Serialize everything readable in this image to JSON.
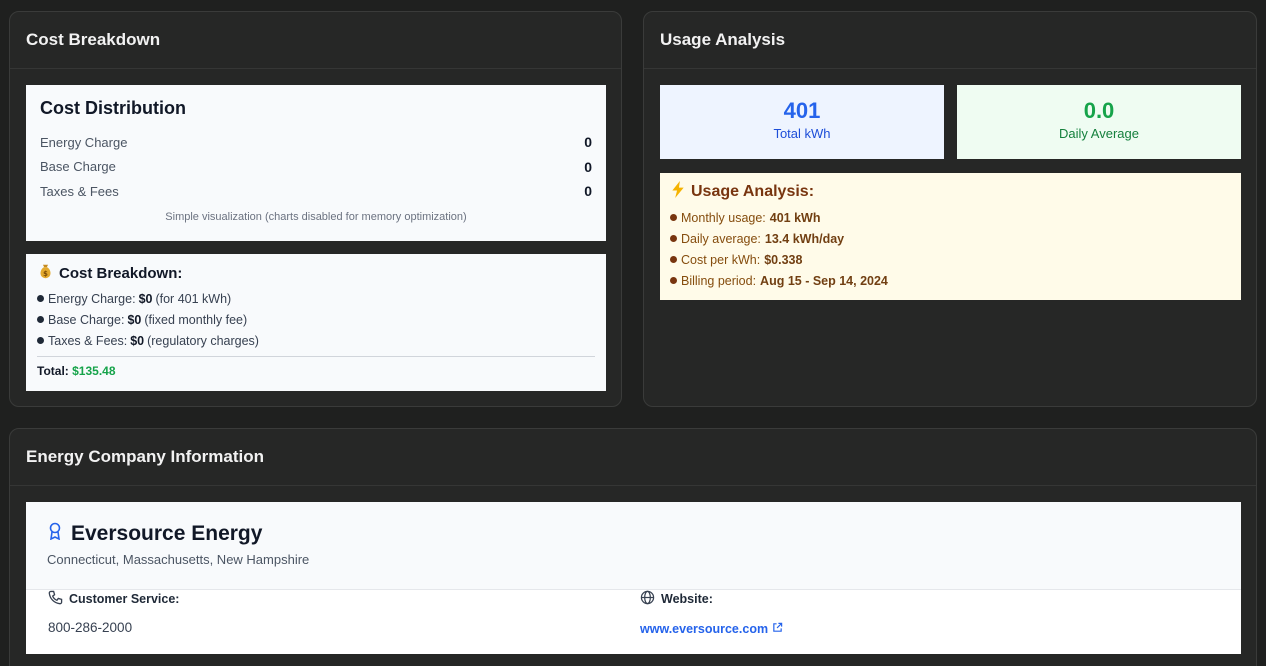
{
  "cost_card": {
    "title": "Cost Breakdown",
    "distribution": {
      "title": "Cost Distribution",
      "rows": [
        {
          "label": "Energy Charge",
          "value": "0"
        },
        {
          "label": "Base Charge",
          "value": "0"
        },
        {
          "label": "Taxes & Fees",
          "value": "0"
        }
      ],
      "note": "Simple visualization (charts disabled for memory optimization)"
    },
    "breakdown": {
      "icon": "money-bag-icon",
      "title": "Cost Breakdown:",
      "lines": [
        {
          "label": "Energy Charge:",
          "amount": "$0",
          "detail": "(for 401 kWh)"
        },
        {
          "label": "Base Charge:",
          "amount": "$0",
          "detail": "(fixed monthly fee)"
        },
        {
          "label": "Taxes & Fees:",
          "amount": "$0",
          "detail": "(regulatory charges)"
        }
      ],
      "total_label": "Total:",
      "total_value": "$135.48"
    }
  },
  "usage_card": {
    "title": "Usage Analysis",
    "stats": {
      "total_value": "401",
      "total_label": "Total kWh",
      "avg_value": "0.0",
      "avg_label": "Daily Average"
    },
    "analysis": {
      "icon": "lightning-icon",
      "title": "Usage Analysis:",
      "lines": [
        {
          "label": "Monthly usage:",
          "value": "401 kWh"
        },
        {
          "label": "Daily average:",
          "value": "13.4 kWh/day"
        },
        {
          "label": "Cost per kWh:",
          "value": "$0.338"
        },
        {
          "label": "Billing period:",
          "value": "Aug 15 - Sep 14, 2024"
        }
      ]
    }
  },
  "company_card": {
    "title": "Energy Company Information",
    "name": "Eversource Energy",
    "region": "Connecticut, Massachusetts, New Hampshire",
    "service_label": "Customer Service:",
    "service_value": "800-286-2000",
    "website_label": "Website:",
    "website_value": "www.eversource.com"
  },
  "colors": {
    "background": "#1f201f",
    "card": "#262726",
    "blue": "#2563eb",
    "green": "#16a34a",
    "amber": "#78350f"
  }
}
